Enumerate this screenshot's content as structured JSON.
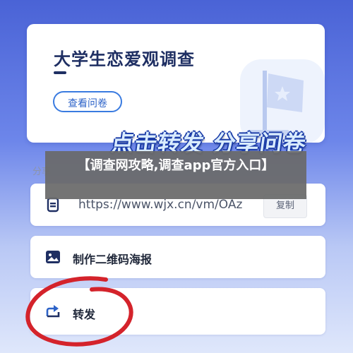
{
  "card": {
    "title": "大学生恋爱观调查",
    "view_button": "查看问卷"
  },
  "promo": "点击转发 分享问卷",
  "share": {
    "label": "分享",
    "url": "https://www.wjx.cn/vm/OAz",
    "copy_label": "复制",
    "qr_label": "制作二维码海报",
    "forward_label": "转发"
  },
  "overlay": {
    "text": "【调查网攻略,调查app官方入口】"
  },
  "colors": {
    "accent": "#3a7be0",
    "title": "#1f2f63",
    "annotation": "#d4232b"
  },
  "icons": {
    "link": "link-icon",
    "qr": "image-icon",
    "forward": "share-forward-icon",
    "flag": "flag-icon"
  }
}
